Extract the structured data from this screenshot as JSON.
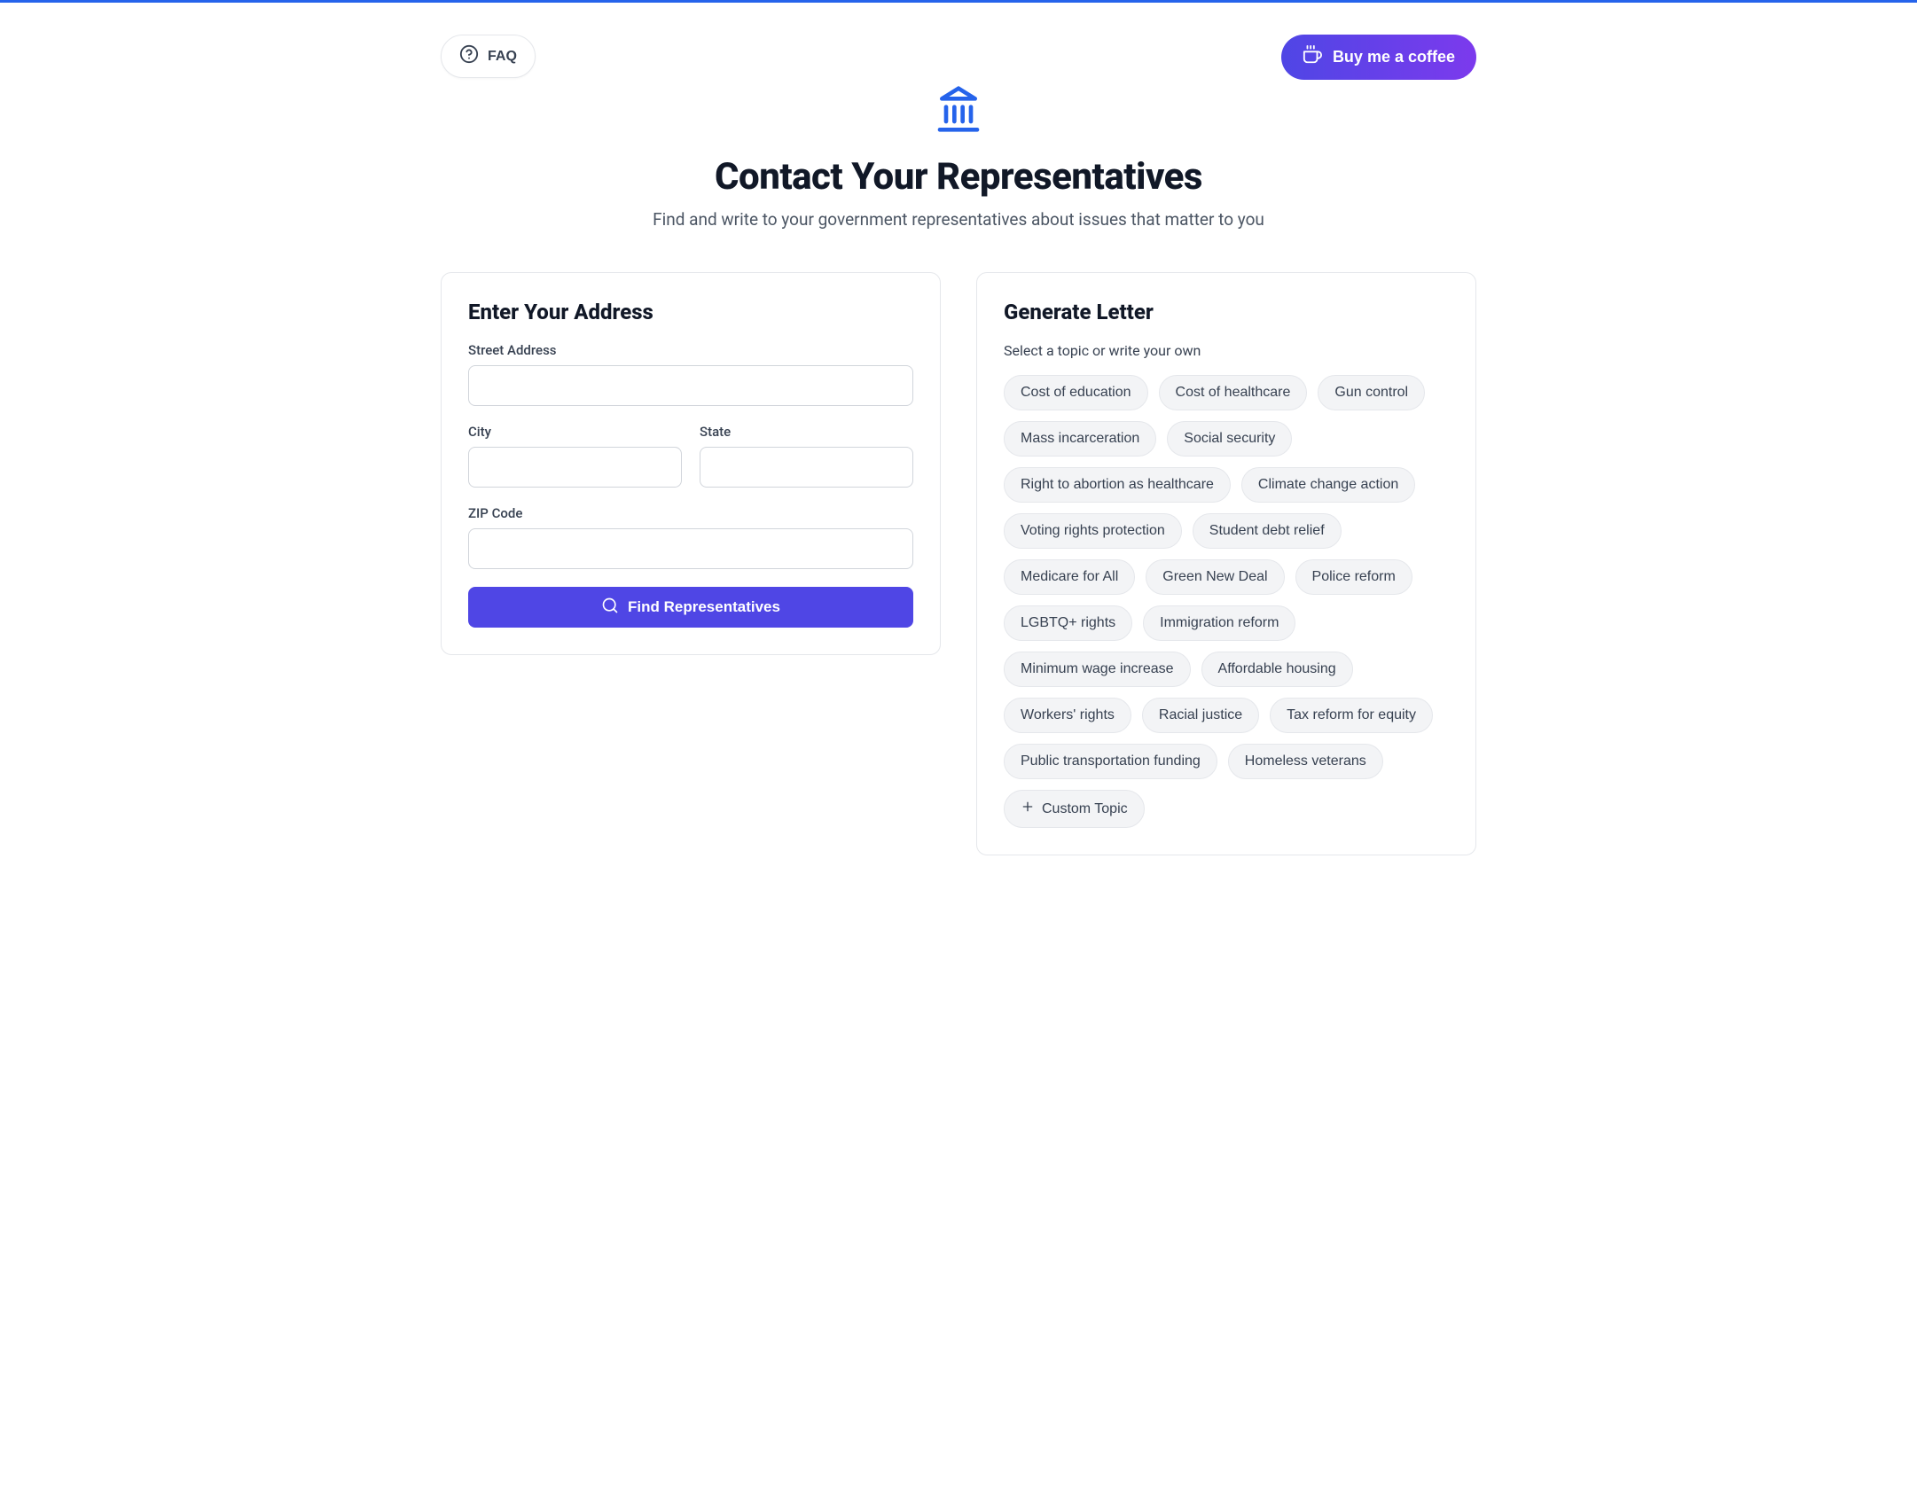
{
  "nav": {
    "faq_label": "FAQ",
    "coffee_label": "Buy me a coffee"
  },
  "header": {
    "title": "Contact Your Representatives",
    "subtitle": "Find and write to your government representatives about issues that matter to you"
  },
  "address_card": {
    "title": "Enter Your Address",
    "fields": {
      "street_label": "Street Address",
      "street_value": "",
      "city_label": "City",
      "city_value": "",
      "state_label": "State",
      "state_value": "",
      "zip_label": "ZIP Code",
      "zip_value": ""
    },
    "find_button_label": "Find Representatives"
  },
  "letter_card": {
    "title": "Generate Letter",
    "subtitle": "Select a topic or write your own",
    "topics": [
      "Cost of education",
      "Cost of healthcare",
      "Gun control",
      "Mass incarceration",
      "Social security",
      "Right to abortion as healthcare",
      "Climate change action",
      "Voting rights protection",
      "Student debt relief",
      "Medicare for All",
      "Green New Deal",
      "Police reform",
      "LGBTQ+ rights",
      "Immigration reform",
      "Minimum wage increase",
      "Affordable housing",
      "Workers' rights",
      "Racial justice",
      "Tax reform for equity",
      "Public transportation funding",
      "Homeless veterans"
    ],
    "custom_topic_label": "Custom Topic"
  }
}
